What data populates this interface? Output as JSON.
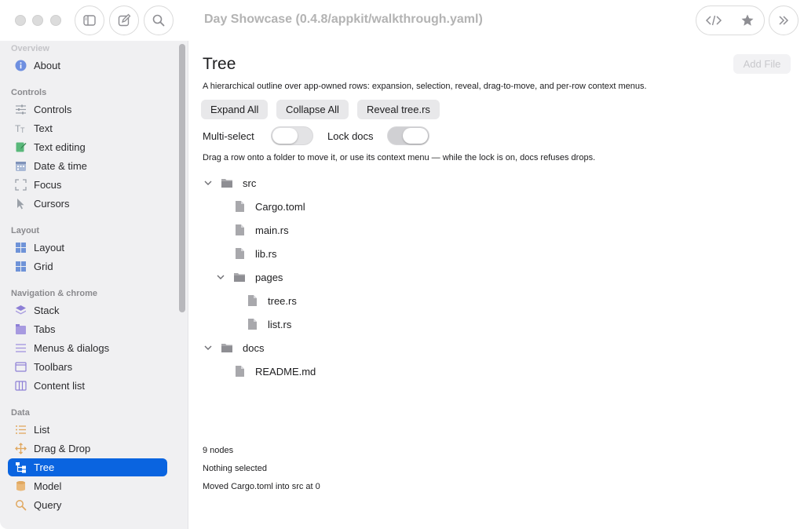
{
  "window": {
    "title": "Day Showcase (0.4.8/appkit/walkthrough.yaml)"
  },
  "sidebar": {
    "sections": [
      {
        "title": "Overview",
        "items": [
          {
            "label": "About",
            "icon": "info-icon"
          }
        ]
      },
      {
        "title": "Controls",
        "items": [
          {
            "label": "Controls",
            "icon": "sliders-icon"
          },
          {
            "label": "Text",
            "icon": "text-icon"
          },
          {
            "label": "Text editing",
            "icon": "edit-icon"
          },
          {
            "label": "Date & time",
            "icon": "calendar-icon"
          },
          {
            "label": "Focus",
            "icon": "focus-icon"
          },
          {
            "label": "Cursors",
            "icon": "cursor-icon"
          }
        ]
      },
      {
        "title": "Layout",
        "items": [
          {
            "label": "Layout",
            "icon": "layout-grid-icon"
          },
          {
            "label": "Grid",
            "icon": "grid-icon"
          }
        ]
      },
      {
        "title": "Navigation & chrome",
        "items": [
          {
            "label": "Stack",
            "icon": "stack-icon"
          },
          {
            "label": "Tabs",
            "icon": "tabs-icon"
          },
          {
            "label": "Menus & dialogs",
            "icon": "menu-icon"
          },
          {
            "label": "Toolbars",
            "icon": "toolbar-icon"
          },
          {
            "label": "Content list",
            "icon": "columns-icon"
          }
        ]
      },
      {
        "title": "Data",
        "items": [
          {
            "label": "List",
            "icon": "list-icon"
          },
          {
            "label": "Drag & Drop",
            "icon": "move-icon"
          },
          {
            "label": "Tree",
            "icon": "tree-icon",
            "active": true
          },
          {
            "label": "Model",
            "icon": "database-icon"
          },
          {
            "label": "Query",
            "icon": "search-icon"
          }
        ]
      }
    ]
  },
  "main": {
    "title": "Tree",
    "add_file_label": "Add File",
    "description": "A hierarchical outline over app-owned rows: expansion, selection, reveal, drag-to-move, and per-row context menus.",
    "buttons": {
      "expand_all": "Expand All",
      "collapse_all": "Collapse All",
      "reveal": "Reveal tree.rs"
    },
    "toggles": {
      "multi_select": {
        "label": "Multi-select",
        "on": false
      },
      "lock_docs": {
        "label": "Lock docs",
        "on": true
      }
    },
    "hint": "Drag a row onto a folder to move it, or use its context menu — while the lock is on, docs refuses drops.",
    "tree": [
      {
        "label": "src",
        "type": "folder",
        "expanded": true
      },
      {
        "label": "Cargo.toml",
        "type": "file"
      },
      {
        "label": "main.rs",
        "type": "file"
      },
      {
        "label": "lib.rs",
        "type": "file"
      },
      {
        "label": "pages",
        "type": "folder",
        "expanded": true
      },
      {
        "label": "tree.rs",
        "type": "file"
      },
      {
        "label": "list.rs",
        "type": "file"
      },
      {
        "label": "docs",
        "type": "folder",
        "expanded": true
      },
      {
        "label": "README.md",
        "type": "file"
      }
    ],
    "status": {
      "count": "9 nodes",
      "selection": "Nothing selected",
      "last_action": "Moved Cargo.toml into src at 0"
    }
  },
  "colors": {
    "accent": "#0a64e0",
    "sidebar_bg": "#f0f0f2"
  }
}
